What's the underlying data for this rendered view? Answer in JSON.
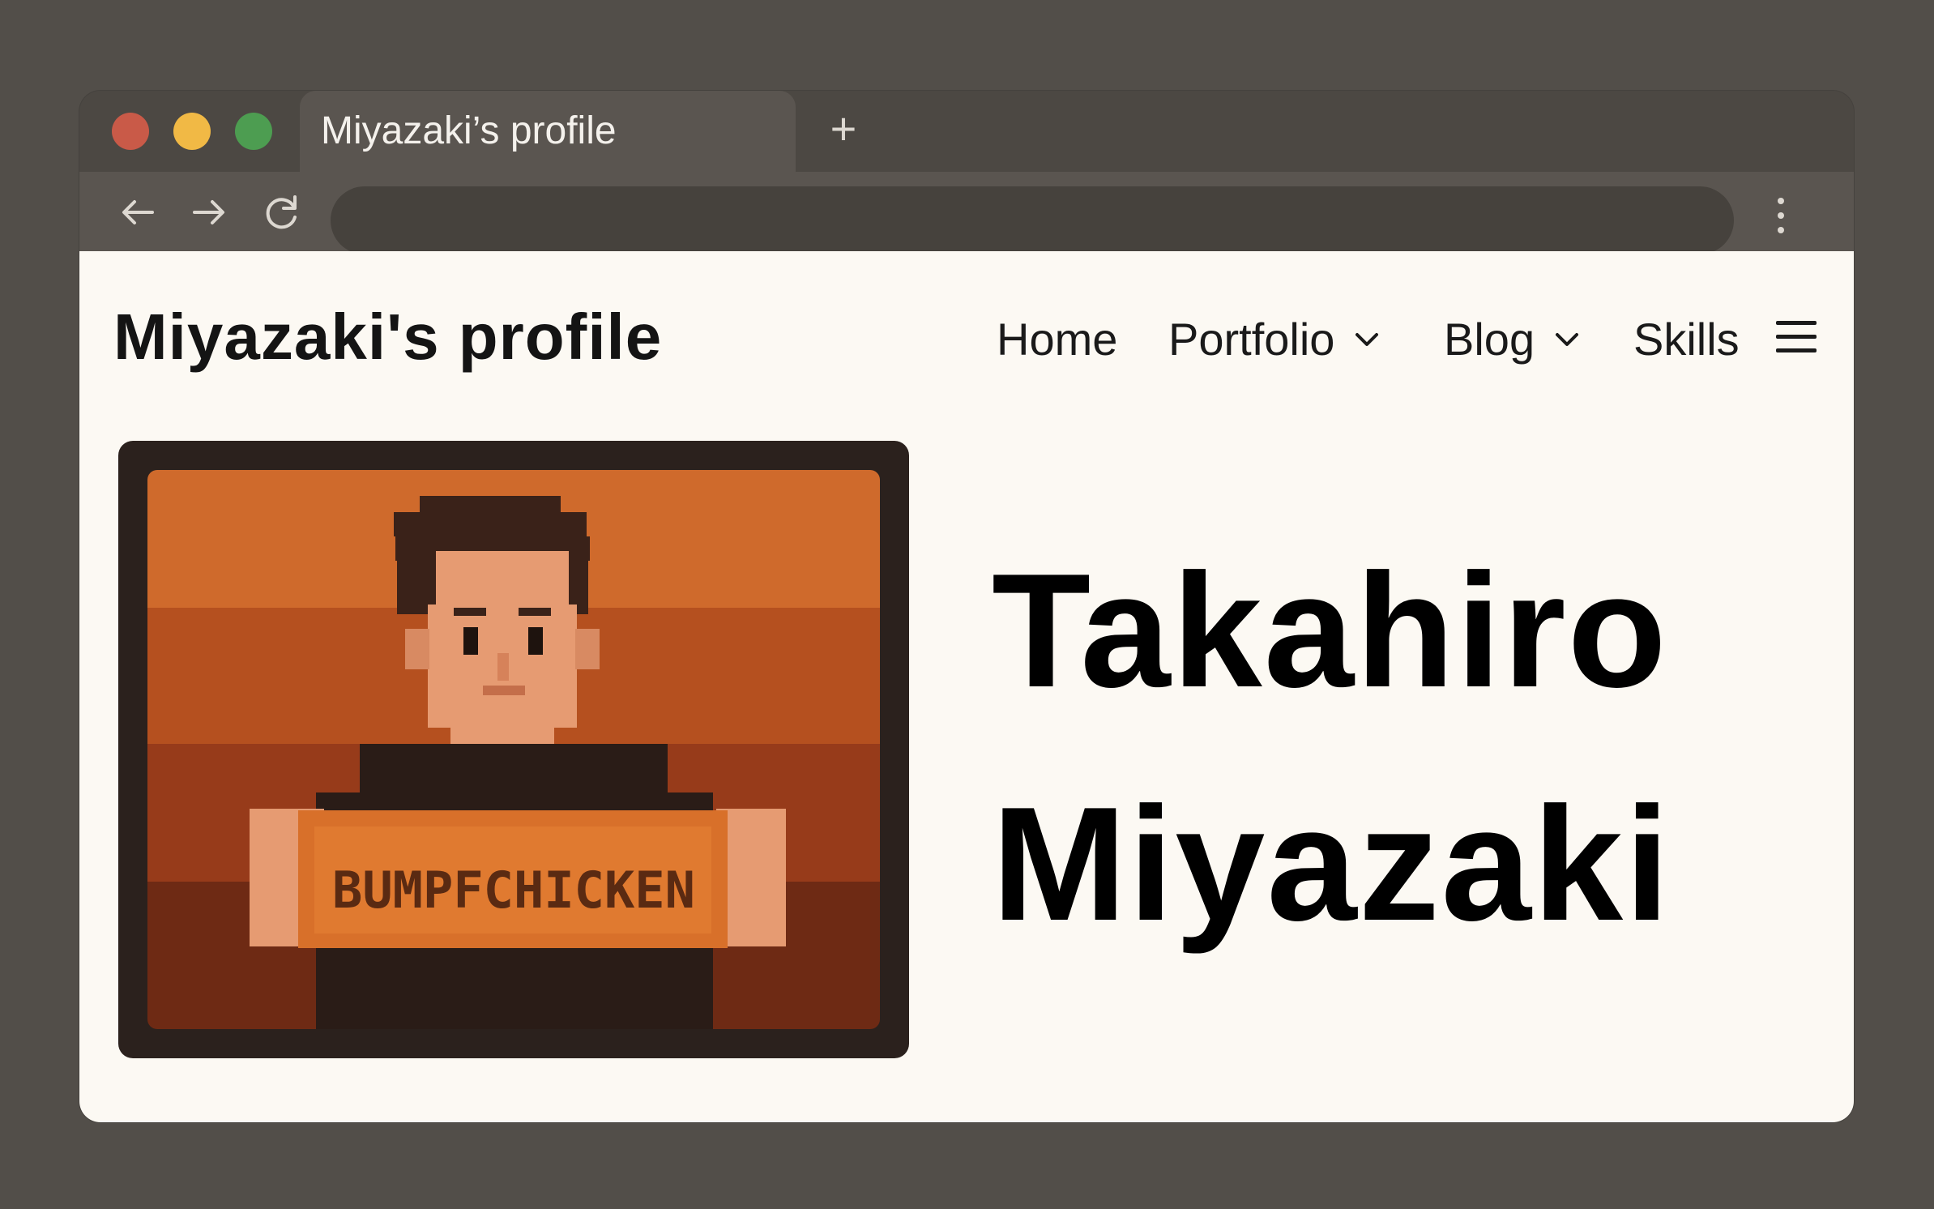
{
  "browser": {
    "tab_title": "Miyazaki’s profile",
    "new_tab_label": "+",
    "url": "",
    "icons": [
      "back-arrow-icon",
      "forward-arrow-icon",
      "reload-icon",
      "kebab-menu-icon"
    ]
  },
  "site": {
    "title": "Miyazaki's profile",
    "nav": [
      {
        "label": "Home",
        "has_dropdown": false
      },
      {
        "label": "Portfolio",
        "has_dropdown": true
      },
      {
        "label": "Blog",
        "has_dropdown": true
      },
      {
        "label": "Skills",
        "has_dropdown": false
      }
    ],
    "menu_icon": "hamburger-menu-icon"
  },
  "hero": {
    "first_name": "Takahiro",
    "last_name": "Miyazaki",
    "image_sign_text": "BUMPFCHICKEN"
  },
  "colors": {
    "page_bg": "#fcf9f3",
    "outer_bg": "#524e49",
    "chrome": "#5a5550",
    "traffic_red": "#c95a48",
    "traffic_yellow": "#f1b945",
    "traffic_green": "#4d9d51"
  }
}
